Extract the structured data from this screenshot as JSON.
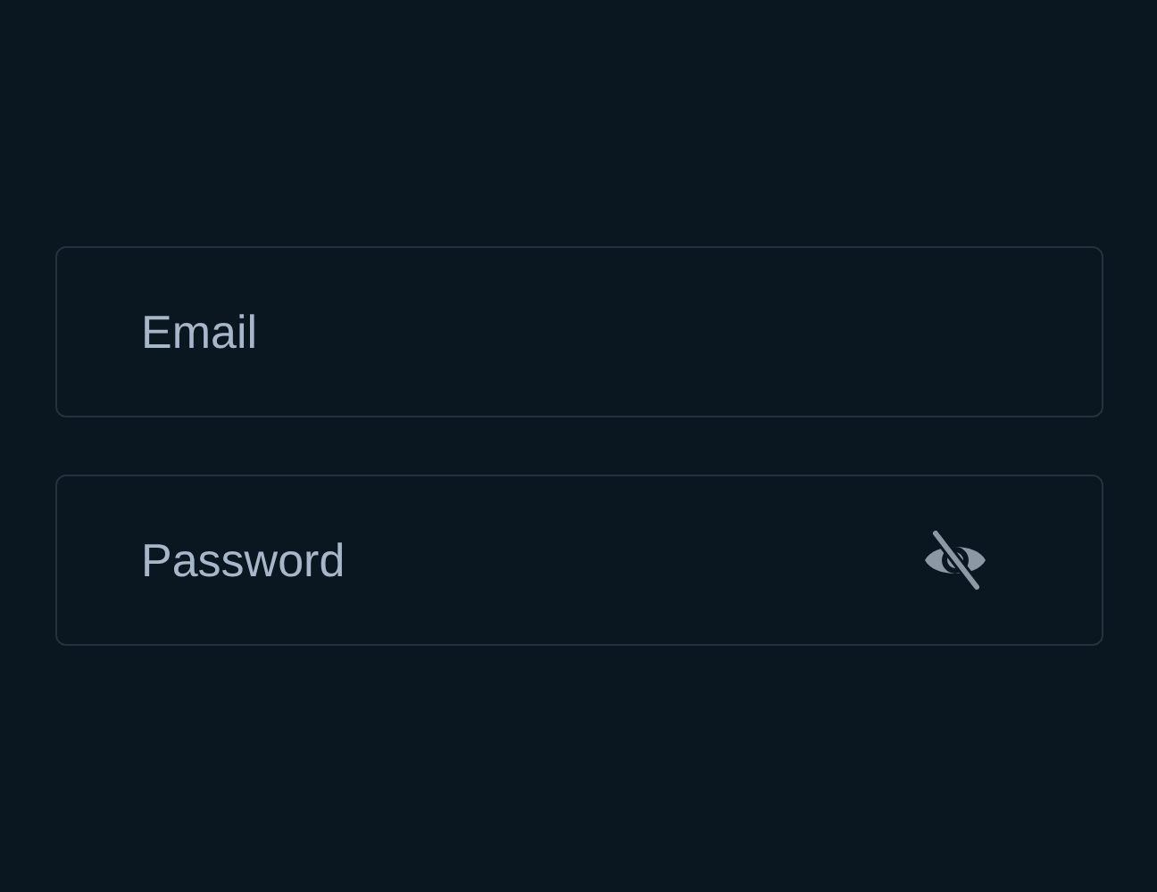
{
  "fields": [
    {
      "kind": "email",
      "placeholder": "Email"
    },
    {
      "kind": "password",
      "placeholder": "Password",
      "revealed": false
    }
  ]
}
